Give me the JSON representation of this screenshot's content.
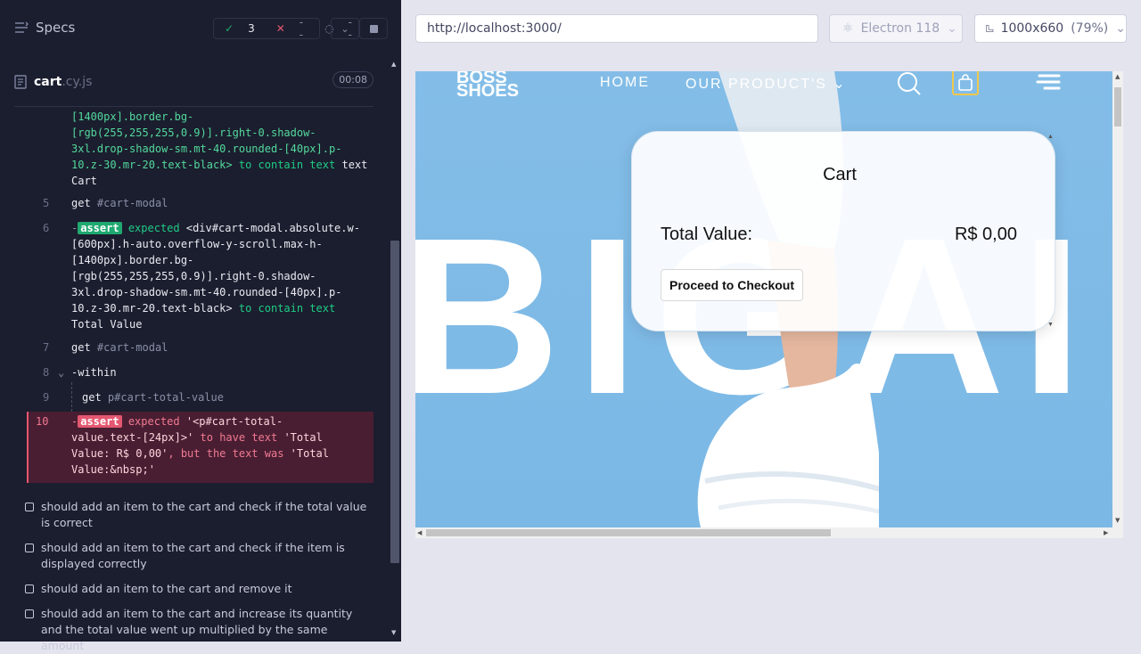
{
  "reporter": {
    "title": "Specs",
    "stats": {
      "passed": "3",
      "failed": "--",
      "pending": "--"
    },
    "spec_file": {
      "name": "cart",
      "ext": ".cy.js",
      "duration": "00:08"
    },
    "commands": [
      {
        "num": "",
        "lines": [
          "[1400px].border.bg-",
          "[rgb(255,255,255,0.9)].right-0.shadow-",
          "3xl.drop-shadow-sm.mt-40.rounded-[40px].p-",
          "10.z-30.mr-20.text-black>"
        ],
        "suffix": "to contain text",
        "value": "Cart"
      },
      {
        "num": "5",
        "text": "get",
        "arg": "#cart-modal"
      },
      {
        "num": "6",
        "badge": "assert",
        "expected": "expected",
        "lines": [
          "<div#cart-modal.absolute.w-",
          "[600px].h-auto.overflow-y-scroll.max-h-",
          "[1400px].border.bg-",
          "[rgb(255,255,255,0.9)].right-0.shadow-",
          "3xl.drop-shadow-sm.mt-40.rounded-[40px].p-",
          "10.z-30.mr-20.text-black>"
        ],
        "suffix": "to contain text",
        "value": "Total Value"
      },
      {
        "num": "7",
        "text": "get",
        "arg": "#cart-modal"
      },
      {
        "num": "8",
        "text": "-within"
      },
      {
        "num": "9",
        "text": "get",
        "arg": "p#cart-total-value"
      },
      {
        "num": "10",
        "badge": "assert",
        "expected": "expected",
        "subject": "'<p#cart-total-",
        "subject2": "value.text-[24px]>'",
        "matcher": "to have text",
        "expected_value": "'Total",
        "expected_value2": "Value: R$ 0,00'",
        "but": ", but the text was",
        "actual": "'Total",
        "actual2": "Value:&nbsp;'"
      }
    ],
    "tests": [
      "should add an item to the cart and check if the total value is correct",
      "should add an item to the cart and check if the item is displayed correctly",
      "should add an item to the cart and remove it",
      "should add an item to the cart and increase its quantity and the total value went up multiplied by the same amount"
    ]
  },
  "browser_bar": {
    "url": "http://localhost:3000/",
    "browser": "Electron 118",
    "viewport": "1000x660",
    "zoom": "(79%)"
  },
  "app": {
    "logo_line1": "BOSS",
    "logo_line2": "SHOES",
    "nav": [
      "HOME",
      "OUR PRODUCT'S"
    ],
    "hero_text": "BIGAIR",
    "cart": {
      "title": "Cart",
      "total_label": "Total Value:",
      "total_value": "R$ 0,00",
      "checkout": "Proceed to Checkout"
    }
  },
  "colors": {
    "pass": "#1fa971",
    "fail": "#e45770",
    "sky": "#7bb8e6"
  }
}
